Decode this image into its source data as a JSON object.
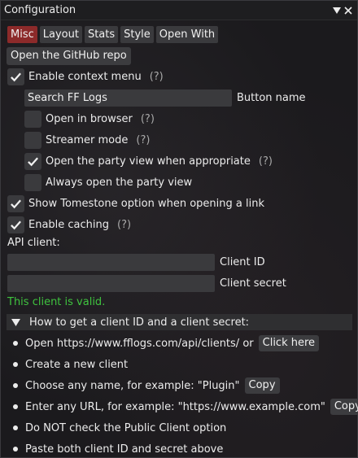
{
  "window": {
    "title": "Configuration"
  },
  "tabs": [
    {
      "label": "Misc",
      "active": true
    },
    {
      "label": "Layout",
      "active": false
    },
    {
      "label": "Stats",
      "active": false
    },
    {
      "label": "Style",
      "active": false
    },
    {
      "label": "Open With",
      "active": false
    }
  ],
  "misc": {
    "github_button": "Open the GitHub repo",
    "enable_context_menu": {
      "label": "Enable context menu",
      "checked": true,
      "help": "(?)"
    },
    "button_name": {
      "value": "Search FF Logs",
      "label": "Button name"
    },
    "open_in_browser": {
      "label": "Open in browser",
      "checked": false,
      "help": "(?)"
    },
    "streamer_mode": {
      "label": "Streamer mode",
      "checked": false,
      "help": "(?)"
    },
    "open_party_view": {
      "label": "Open the party view when appropriate",
      "checked": true,
      "help": "(?)"
    },
    "always_party_view": {
      "label": "Always open the party view",
      "checked": false
    },
    "show_tomestone": {
      "label": "Show Tomestone option when opening a link",
      "checked": true
    },
    "enable_caching": {
      "label": "Enable caching",
      "checked": true,
      "help": "(?)"
    },
    "api_client_label": "API client:",
    "client_id": {
      "value": "",
      "label": "Client ID"
    },
    "client_secret": {
      "value": "",
      "label": "Client secret"
    },
    "status": "This client is valid.",
    "howto": {
      "header": "How to get a client ID and a client secret:",
      "steps": [
        {
          "text": "Open https://www.fflogs.com/api/clients/ or",
          "button": "Click here"
        },
        {
          "text": "Create a new client"
        },
        {
          "text": "Choose any name, for example: \"Plugin\"",
          "button": "Copy"
        },
        {
          "text": "Enter any URL, for example: \"https://www.example.com\"",
          "button": "Copy"
        },
        {
          "text": "Do NOT check the Public Client option"
        },
        {
          "text": "Paste both client ID and secret above"
        }
      ]
    }
  },
  "colors": {
    "accent_tab": "#8c2a2a",
    "valid": "#3fc33f"
  }
}
